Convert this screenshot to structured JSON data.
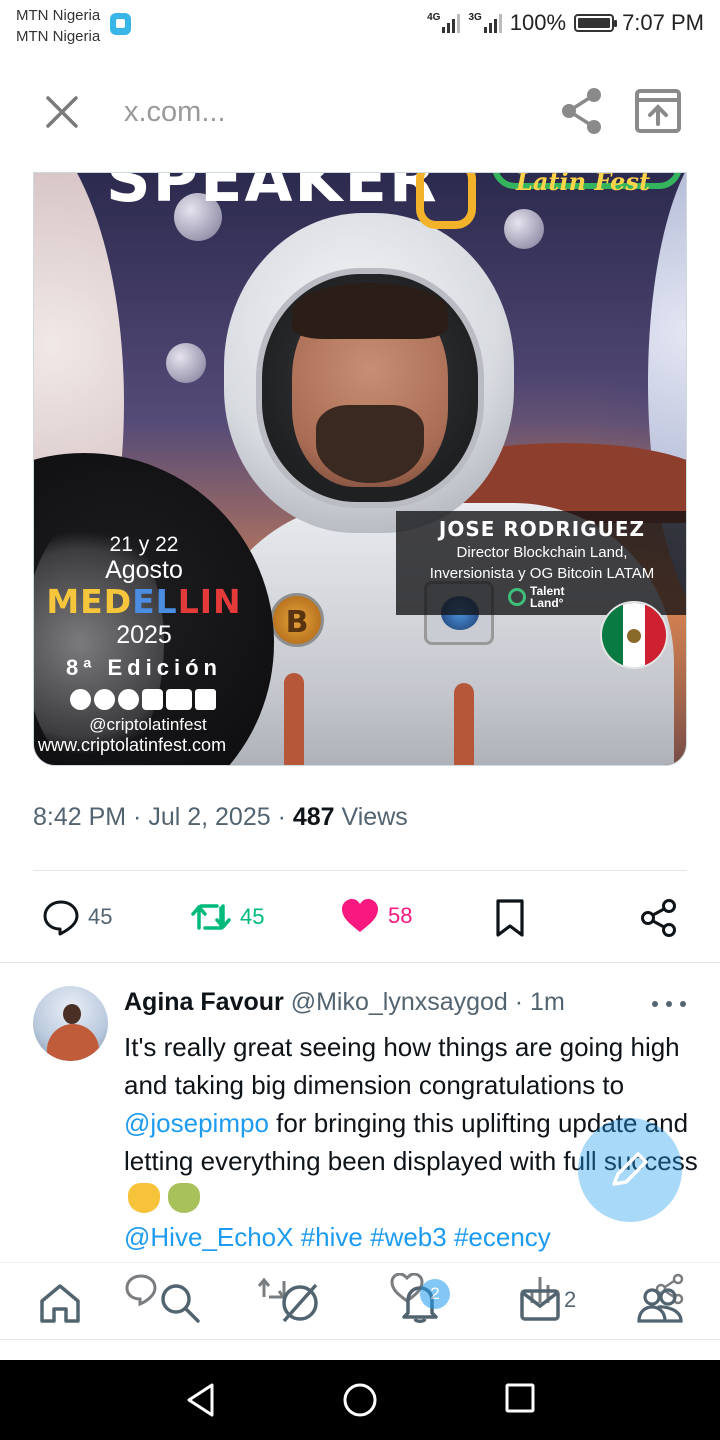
{
  "status_bar": {
    "carrier_1": "MTN Nigeria",
    "carrier_2": "MTN Nigeria",
    "net_1": "4G",
    "net_2": "3G",
    "battery": "100%",
    "time": "7:07 PM"
  },
  "browser": {
    "url": "x.com...",
    "icons": [
      "close-icon",
      "share-icon",
      "open-in-browser-icon"
    ]
  },
  "poster": {
    "header_word": "SPEAKER",
    "fest_script": "Latin Fest",
    "dates": "21 y 22",
    "month": "Agosto",
    "city": [
      "MED",
      "EL",
      "LIN"
    ],
    "year": "2025",
    "edition": "8ª Edición",
    "handle": "@criptolatinfest",
    "website": "www.criptolatinfest.com",
    "speaker_name": "JOSE RODRIGUEZ",
    "speaker_role_1": "Director Blockchain Land,",
    "speaker_role_2": "Inversionista y OG Bitcoin LATAM",
    "sponsor_1": "Talent",
    "sponsor_2": "Land°",
    "bitcoin_symbol": "B"
  },
  "tweet_meta": {
    "time": "8:42 PM · Jul 2, 2025 · ",
    "views_count": "487",
    "views_label": " Views"
  },
  "actions": {
    "replies": "45",
    "reposts": "45",
    "likes": "58",
    "colors": {
      "repost": "#00ba7c",
      "like": "#f91880",
      "muted": "#536471"
    }
  },
  "reply": {
    "author": "Agina Favour",
    "meta": " @Miko_lynxsaygod · 1m",
    "text_before": "It's really great seeing how things are going high and taking big dimension congratulations to ",
    "mention_1": "@josepimpo",
    "text_after": " for bringing this uplifting update and letting everything been displayed with full success",
    "mention_2": "@Hive_EchoX",
    "tags": [
      "#hive",
      "#web3",
      "#ecency"
    ]
  },
  "bottom_toolbar": {
    "notification_badge": "2",
    "message_count": "2"
  },
  "accent_color": "#1d9bf0"
}
